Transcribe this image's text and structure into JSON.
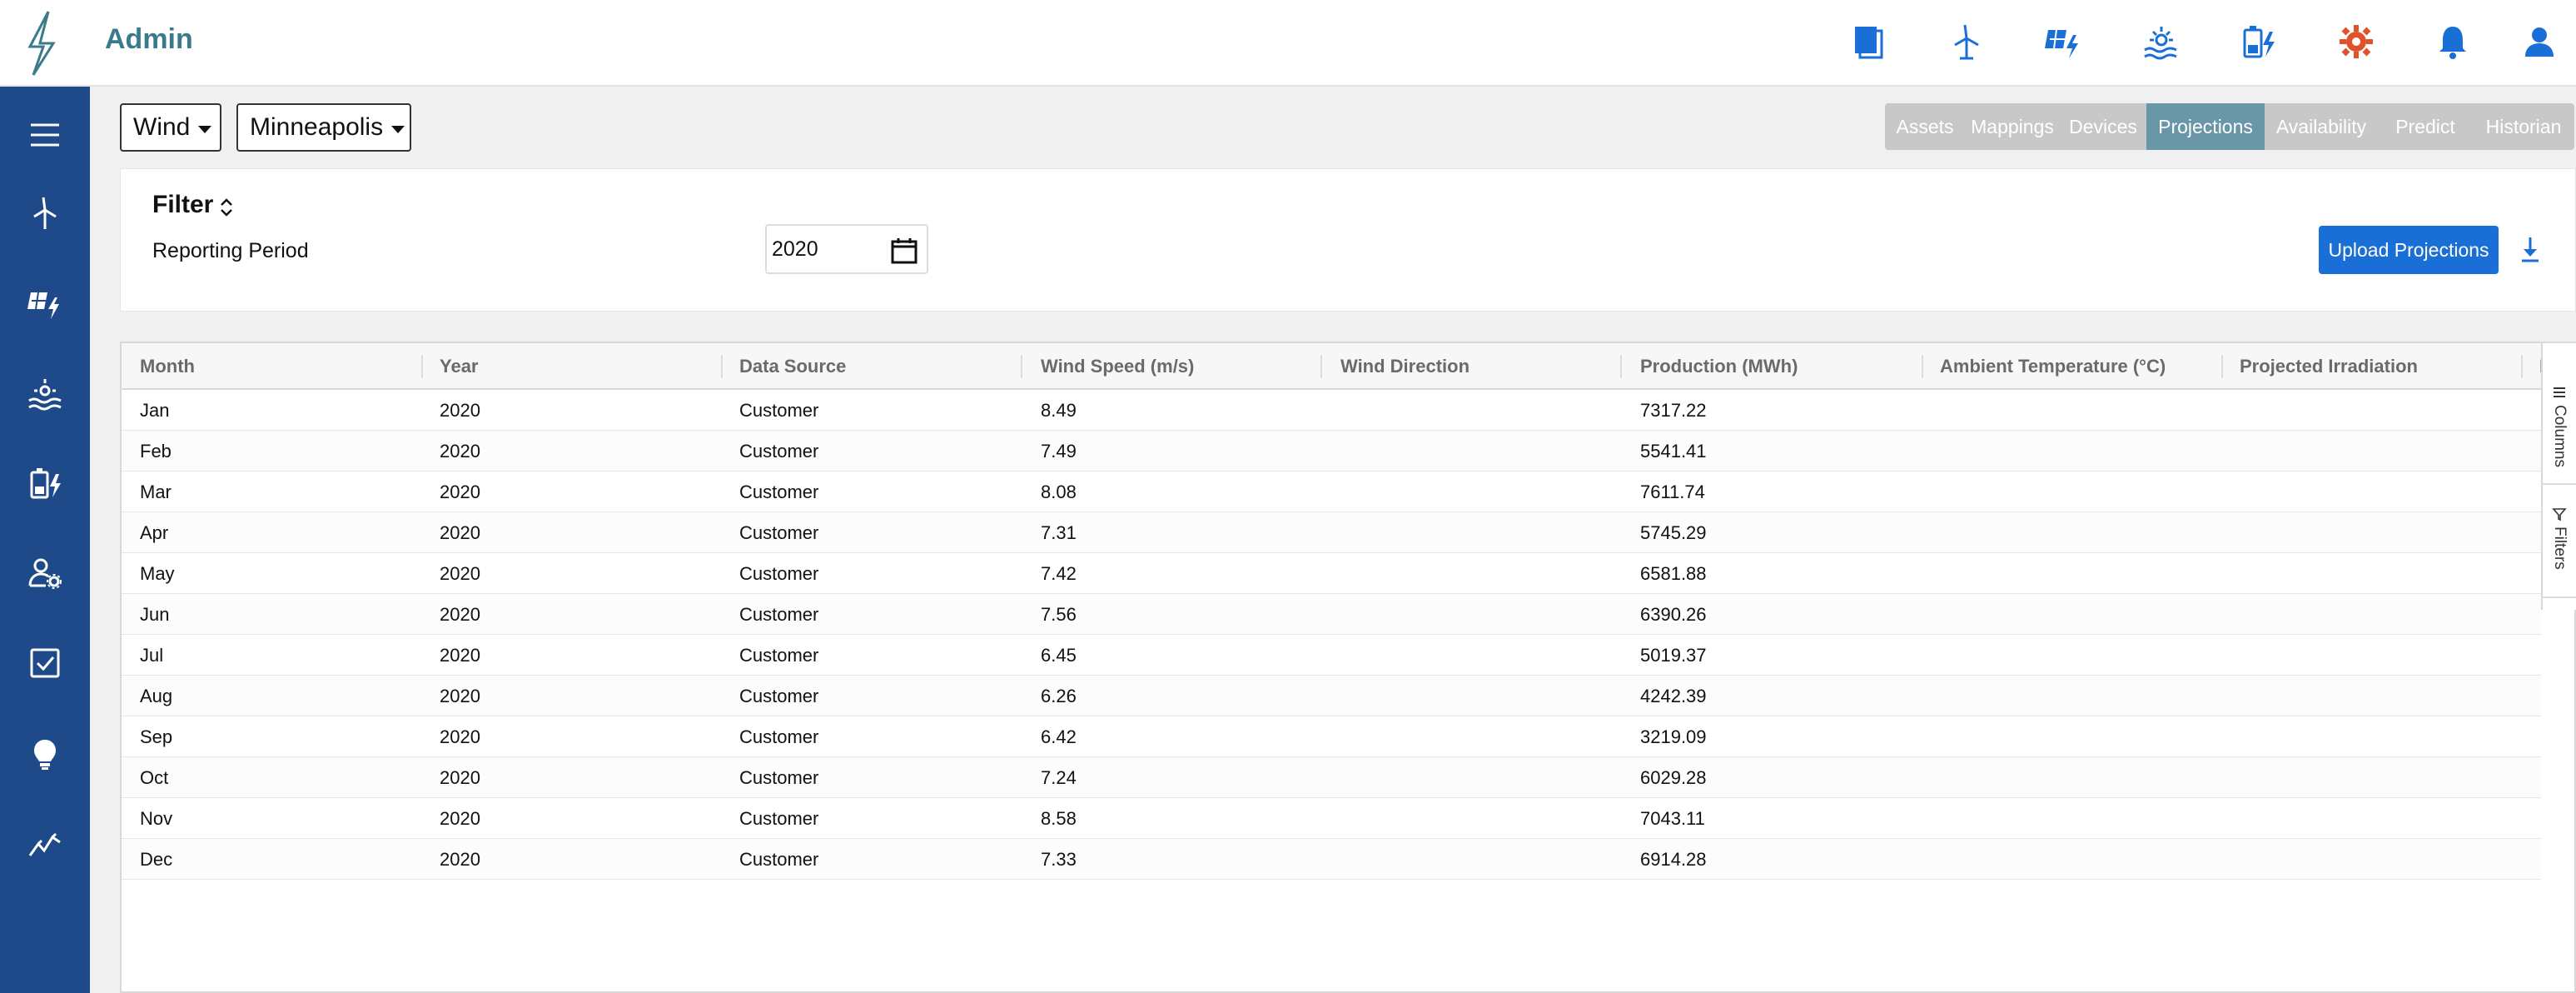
{
  "header": {
    "title": "Admin",
    "icons": [
      "documents-icon",
      "wind-turbine-icon",
      "solar-panel-icon",
      "hydro-icon",
      "battery-icon",
      "settings-icon",
      "notifications-icon",
      "user-icon"
    ]
  },
  "sidebar": {
    "items": [
      "menu-icon",
      "wind-turbine-icon",
      "solar-panel-icon",
      "hydro-icon",
      "battery-icon",
      "user-settings-icon",
      "checkbox-icon",
      "lightbulb-icon",
      "trend-icon"
    ]
  },
  "selectors": {
    "asset_type": "Wind",
    "site": "Minneapolis"
  },
  "tabs": [
    {
      "label": "Assets",
      "active": false
    },
    {
      "label": "Mappings",
      "active": false
    },
    {
      "label": "Devices",
      "active": false
    },
    {
      "label": "Projections",
      "active": true
    },
    {
      "label": "Availability",
      "active": false
    },
    {
      "label": "Predict",
      "active": false
    },
    {
      "label": "Historian",
      "active": false
    }
  ],
  "filter": {
    "title": "Filter",
    "reporting_period_label": "Reporting Period",
    "reporting_period_value": "2020",
    "upload_label": "Upload Projections"
  },
  "grid": {
    "columns": [
      "Month",
      "Year",
      "Data Source",
      "Wind Speed (m/s)",
      "Wind Direction",
      "Production (MWh)",
      "Ambient Temperature (°C)",
      "Projected Irradiation",
      "I"
    ],
    "rows": [
      [
        "Jan",
        "2020",
        "Customer",
        "8.49",
        "",
        "7317.22",
        "",
        ""
      ],
      [
        "Feb",
        "2020",
        "Customer",
        "7.49",
        "",
        "5541.41",
        "",
        ""
      ],
      [
        "Mar",
        "2020",
        "Customer",
        "8.08",
        "",
        "7611.74",
        "",
        ""
      ],
      [
        "Apr",
        "2020",
        "Customer",
        "7.31",
        "",
        "5745.29",
        "",
        ""
      ],
      [
        "May",
        "2020",
        "Customer",
        "7.42",
        "",
        "6581.88",
        "",
        ""
      ],
      [
        "Jun",
        "2020",
        "Customer",
        "7.56",
        "",
        "6390.26",
        "",
        ""
      ],
      [
        "Jul",
        "2020",
        "Customer",
        "6.45",
        "",
        "5019.37",
        "",
        ""
      ],
      [
        "Aug",
        "2020",
        "Customer",
        "6.26",
        "",
        "4242.39",
        "",
        ""
      ],
      [
        "Sep",
        "2020",
        "Customer",
        "6.42",
        "",
        "3219.09",
        "",
        ""
      ],
      [
        "Oct",
        "2020",
        "Customer",
        "7.24",
        "",
        "6029.28",
        "",
        ""
      ],
      [
        "Nov",
        "2020",
        "Customer",
        "8.58",
        "",
        "7043.11",
        "",
        ""
      ],
      [
        "Dec",
        "2020",
        "Customer",
        "7.33",
        "",
        "6914.28",
        "",
        ""
      ]
    ],
    "side_panel": {
      "columns_label": "Columns",
      "filters_label": "Filters"
    }
  },
  "colors": {
    "sidebar": "#1e4a8a",
    "header_icon": "#1a6fd6",
    "settings_icon": "#e0522b",
    "title": "#3a7a8c",
    "active_tab": "#6a97a8",
    "upload_button": "#1a6fd6"
  }
}
